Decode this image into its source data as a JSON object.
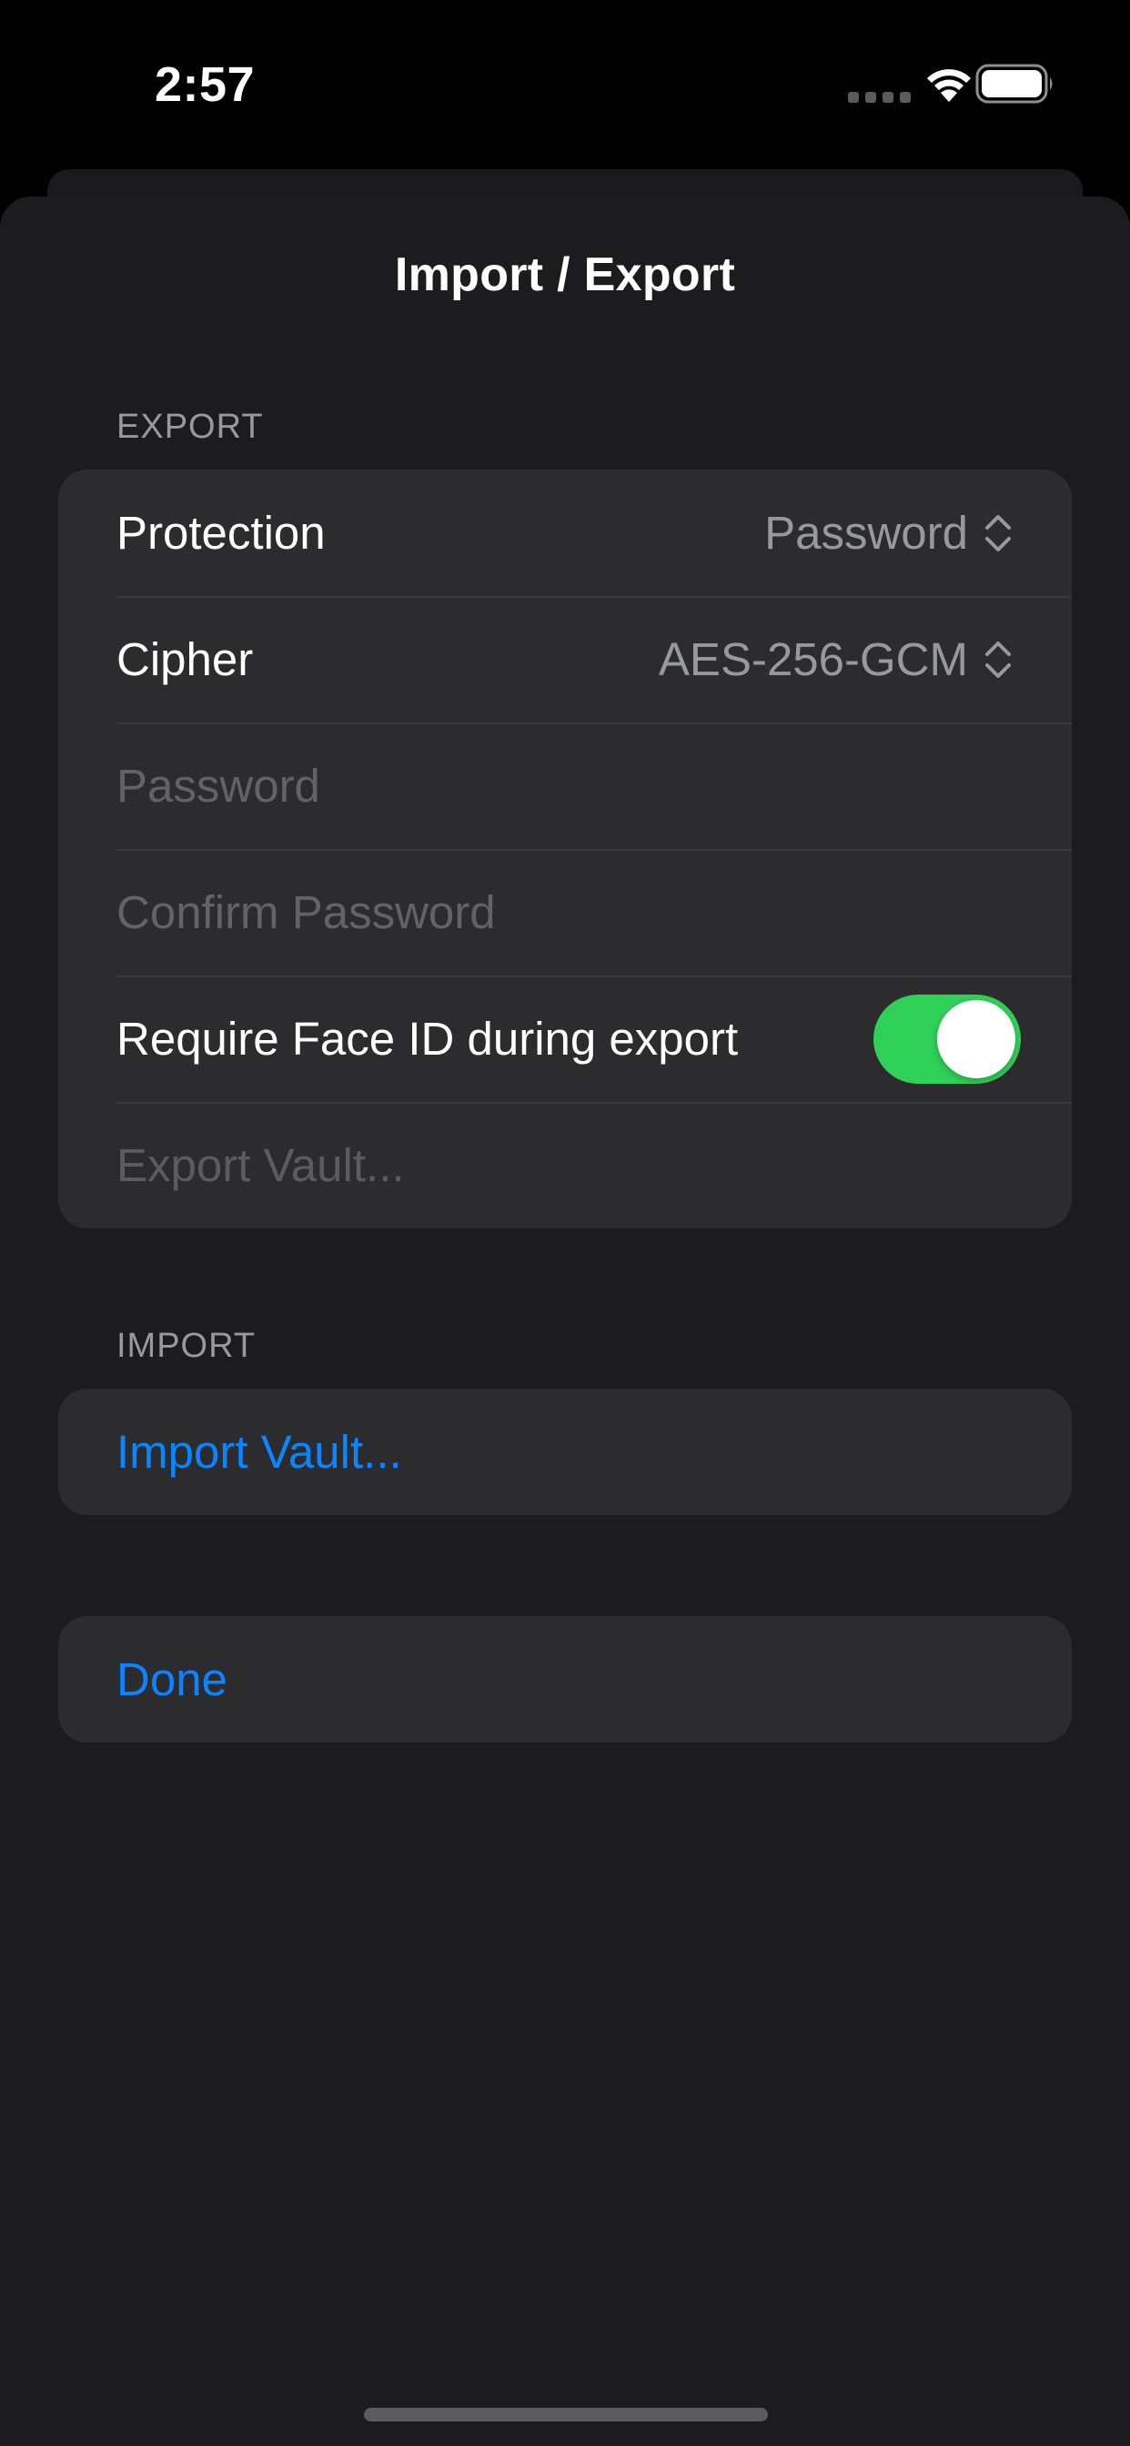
{
  "status_bar": {
    "time": "2:57",
    "icons": [
      "cellular-signal-icon",
      "wifi-icon",
      "battery-icon"
    ]
  },
  "sheet": {
    "title": "Import / Export"
  },
  "export_section": {
    "header": "EXPORT",
    "protection": {
      "label": "Protection",
      "value": "Password"
    },
    "cipher": {
      "label": "Cipher",
      "value": "AES-256-GCM"
    },
    "password_field": {
      "placeholder": "Password",
      "value": ""
    },
    "confirm_password_field": {
      "placeholder": "Confirm Password",
      "value": ""
    },
    "face_id_toggle": {
      "label": "Require Face ID during export",
      "on": true
    },
    "export_button": {
      "label": "Export Vault..."
    }
  },
  "import_section": {
    "header": "IMPORT",
    "import_button": {
      "label": "Import Vault..."
    }
  },
  "done_button": {
    "label": "Done"
  },
  "colors": {
    "accent": "#0a84ff",
    "toggle_on": "#30d158",
    "background": "#1c1c1e",
    "cell": "#2c2c2e"
  }
}
